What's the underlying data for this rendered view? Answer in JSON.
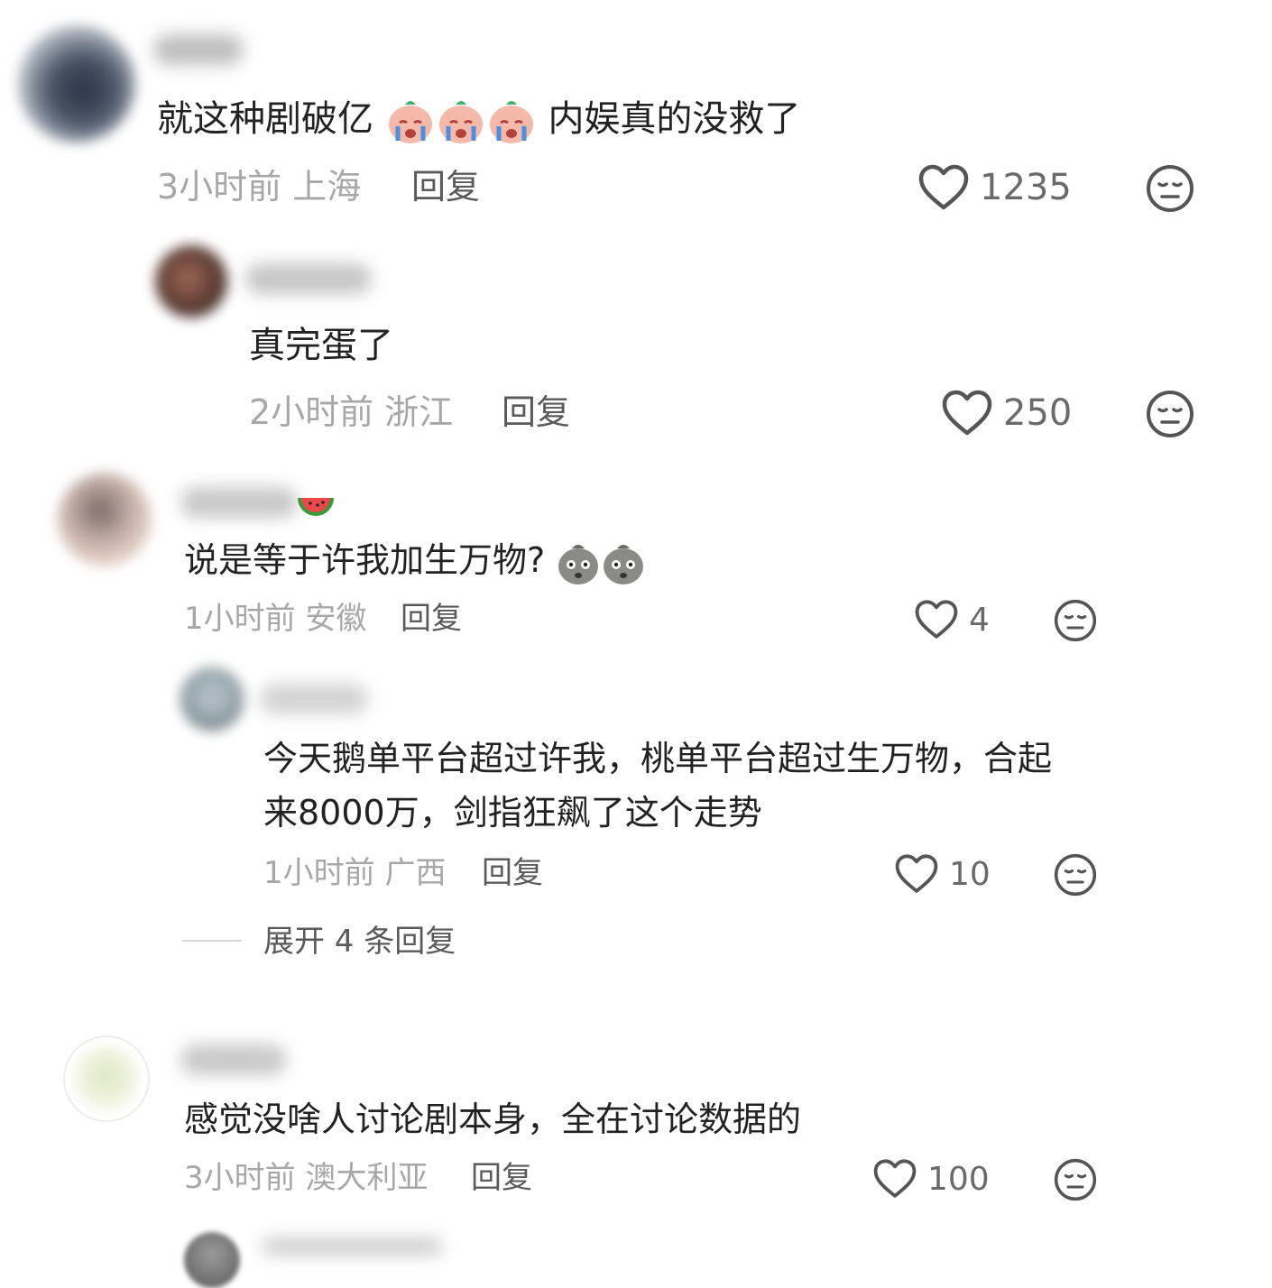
{
  "comments": [
    {
      "text": "就这种剧破亿",
      "text_tail": "内娱真的没救了",
      "emoji": "crying-face",
      "emoji_count": 3,
      "time": "3小时前",
      "location": "上海",
      "reply": "回复",
      "likes": "1235",
      "replies": [
        {
          "text": "真完蛋了",
          "time": "2小时前",
          "location": "浙江",
          "reply": "回复",
          "likes": "250"
        }
      ]
    },
    {
      "text": "说是等于许我加生万物?",
      "emoji": "potato-face",
      "emoji_count": 2,
      "time": "1小时前",
      "location": "安徽",
      "reply": "回复",
      "likes": "4",
      "replies": [
        {
          "text_line1": "今天鹅单平台超过许我，桃单平台超过生万物，合起",
          "text_line2": "来8000万，剑指狂飙了这个走势",
          "time": "1小时前",
          "location": "广西",
          "reply": "回复",
          "likes": "10"
        }
      ],
      "expand_label": "展开 4 条回复"
    },
    {
      "text": "感觉没啥人讨论剧本身，全在讨论数据的",
      "time": "3小时前",
      "location": "澳大利亚",
      "reply": "回复",
      "likes": "100"
    }
  ],
  "icons": {
    "like": "heart-outline-icon",
    "dislike": "neutral-face-icon"
  },
  "colors": {
    "text": "#222222",
    "meta": "#a7a7a7",
    "reply": "#5a5a5a",
    "icon": "#666666"
  }
}
